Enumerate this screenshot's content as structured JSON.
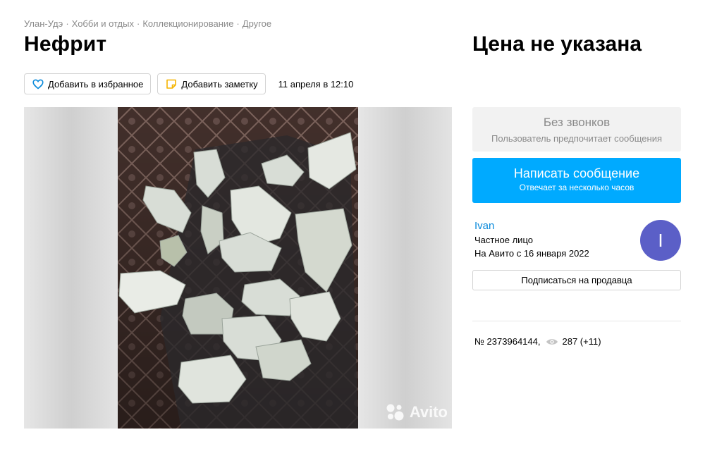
{
  "breadcrumb": [
    "Улан-Удэ",
    "Хобби и отдых",
    "Коллекционирование",
    "Другое"
  ],
  "breadcrumb_sep": "·",
  "listing": {
    "title": "Нефрит",
    "price": "Цена не указана",
    "date": "11 апреля в 12:10",
    "number": "№ 2373964144,",
    "views": "287 (+11)"
  },
  "actions": {
    "favorite_label": "Добавить в избранное",
    "note_label": "Добавить заметку"
  },
  "gallery": {
    "watermark": "Avito"
  },
  "contact": {
    "no_calls_title": "Без звонков",
    "no_calls_sub": "Пользователь предпочитает сообщения",
    "write_title": "Написать сообщение",
    "write_sub": "Отвечает за несколько часов"
  },
  "seller": {
    "name": "Ivan",
    "type": "Частное лицо",
    "since": "На Авито с 16 января 2022",
    "avatar_letter": "I",
    "subscribe_label": "Подписаться на продавца"
  },
  "colors": {
    "accent_blue": "#00aaff",
    "link_blue": "#0a8adb",
    "avatar_bg": "#5b5fc7",
    "muted_text": "#8a8a8a",
    "panel_bg": "#f2f2f2"
  },
  "icons": {
    "favorite": "heart-icon",
    "note": "note-icon",
    "views": "eye-icon",
    "watermark": "avito-logo-icon"
  }
}
